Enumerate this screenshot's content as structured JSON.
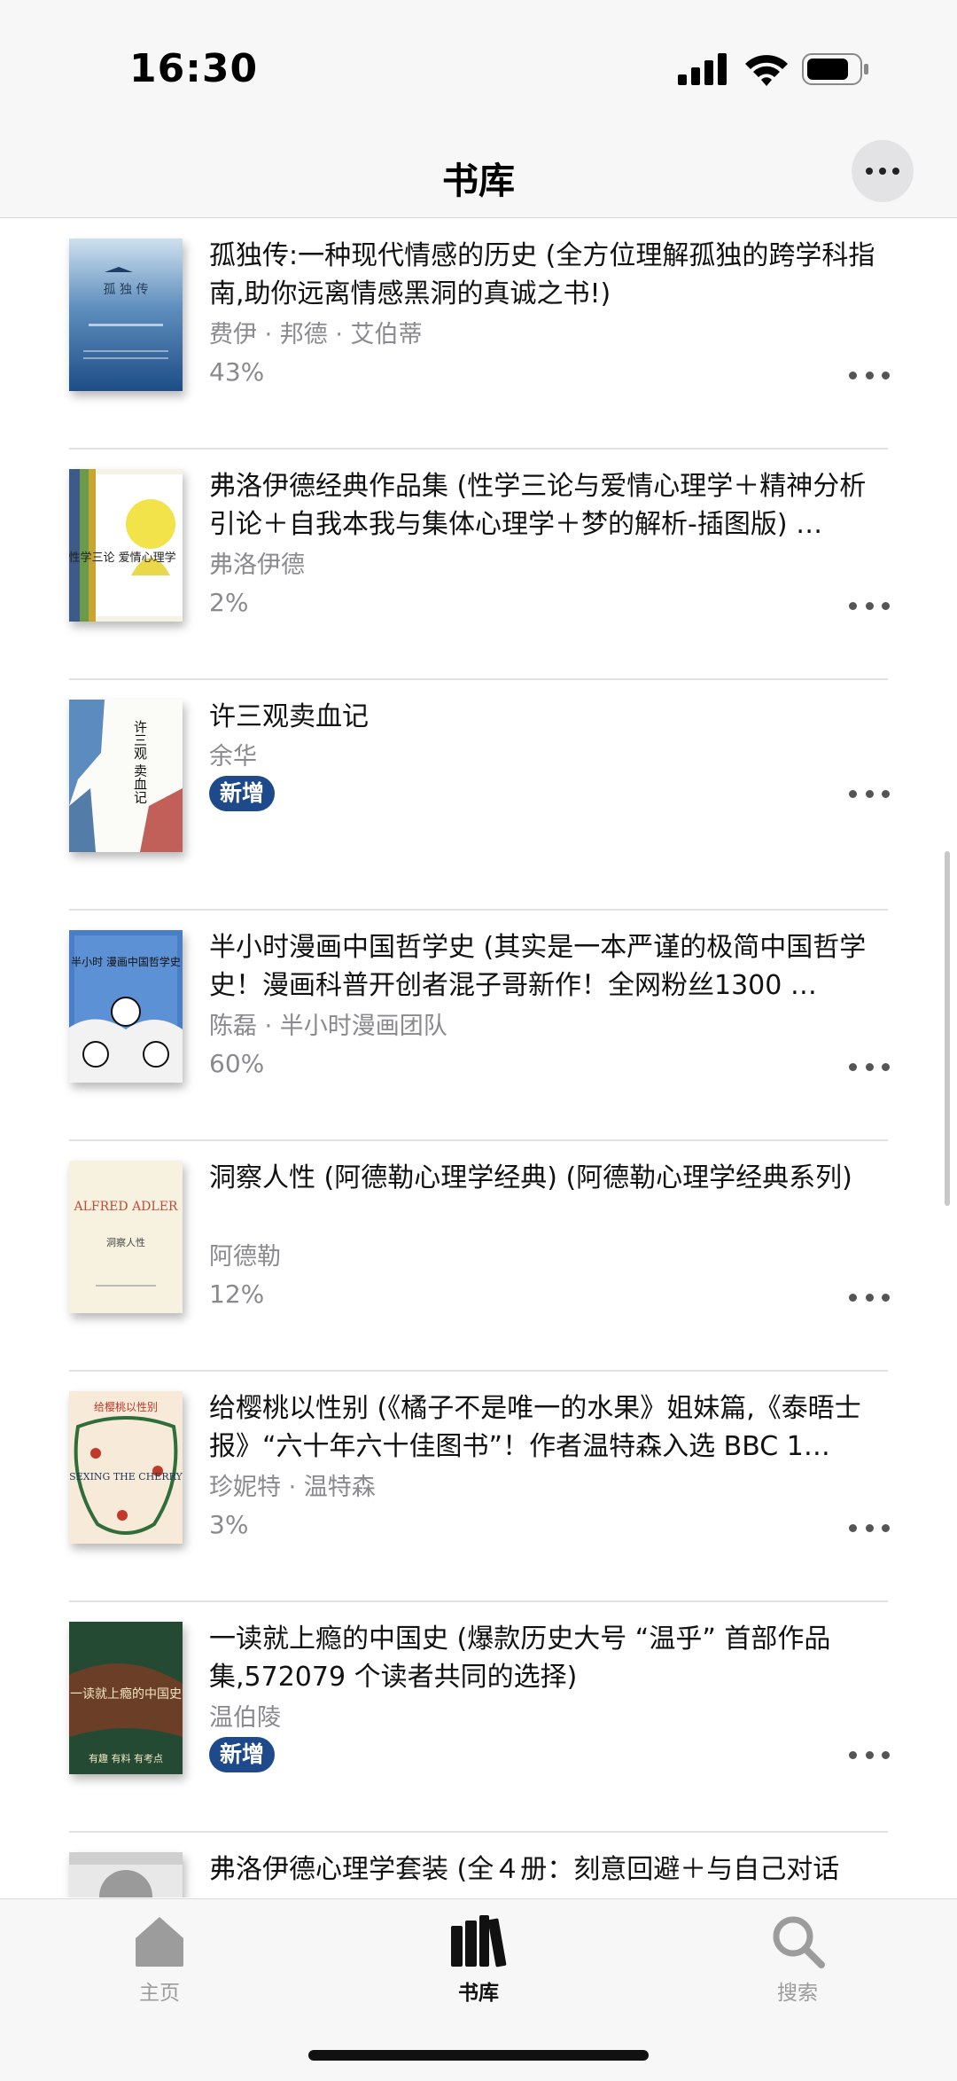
{
  "status_bar": {
    "time": "16:30"
  },
  "nav": {
    "title": "书库"
  },
  "books": [
    {
      "title": "孤独传:一种现代情感的历史 (全方位理解孤独的跨学科指南,助你远离情感黑洞的真诚之书!)",
      "author": "费伊 · 邦德 · 艾伯蒂",
      "progress": "43%",
      "badge": ""
    },
    {
      "title": "弗洛伊德经典作品集 (性学三论与爱情心理学＋精神分析引论＋自我本我与集体心理学＋梦的解析-插图版) …",
      "author": "弗洛伊德",
      "progress": "2%",
      "badge": ""
    },
    {
      "title": "许三观卖血记",
      "author": "余华",
      "progress": "",
      "badge": "新增"
    },
    {
      "title": "半小时漫画中国哲学史 (其实是一本严谨的极简中国哲学史！漫画科普开创者混子哥新作！全网粉丝1300 …",
      "author": "陈磊 · 半小时漫画团队",
      "progress": "60%",
      "badge": ""
    },
    {
      "title": "洞察人性 (阿德勒心理学经典) (阿德勒心理学经典系列)",
      "author": "阿德勒",
      "progress": "12%",
      "badge": ""
    },
    {
      "title": "给樱桃以性别 (《橘子不是唯一的水果》姐妹篇,《泰晤士报》“六十年六十佳图书”！作者温特森入选 BBC 1…",
      "author": "珍妮特 · 温特森",
      "progress": "3%",
      "badge": ""
    },
    {
      "title": "一读就上瘾的中国史 (爆款历史大号 “温乎” 首部作品集,572079 个读者共同的选择)",
      "author": "温伯陵",
      "progress": "",
      "badge": "新增"
    },
    {
      "title": "弗洛伊德心理学套装 (全４册：刻意回避＋与自己对话",
      "author": "",
      "progress": "",
      "badge": ""
    }
  ],
  "covers": {
    "cover_1_text": "孤 独 传",
    "cover_2_text": "性学三论 爱情心理学",
    "cover_3_text": "许三观 卖血记",
    "cover_4_text": "半小时 漫画中国哲学史",
    "cover_5_text": "ALFRED ADLER",
    "cover_5_sub": "洞察人性",
    "cover_6_text": "给樱桃以性别",
    "cover_6_sub": "SEXING THE CHERRY",
    "cover_7_text": "一读就上瘾的中国史",
    "cover_7_sub": "有趣 有料 有考点"
  },
  "tabs": [
    {
      "label": "主页",
      "icon": "home-icon",
      "active": false
    },
    {
      "label": "书库",
      "icon": "library-icon",
      "active": true
    },
    {
      "label": "搜索",
      "icon": "search-icon",
      "active": false
    }
  ],
  "colors": {
    "badge_bg": "#1e4a8c",
    "active_tab": "#111111",
    "inactive_tab": "#9c9c9c"
  }
}
